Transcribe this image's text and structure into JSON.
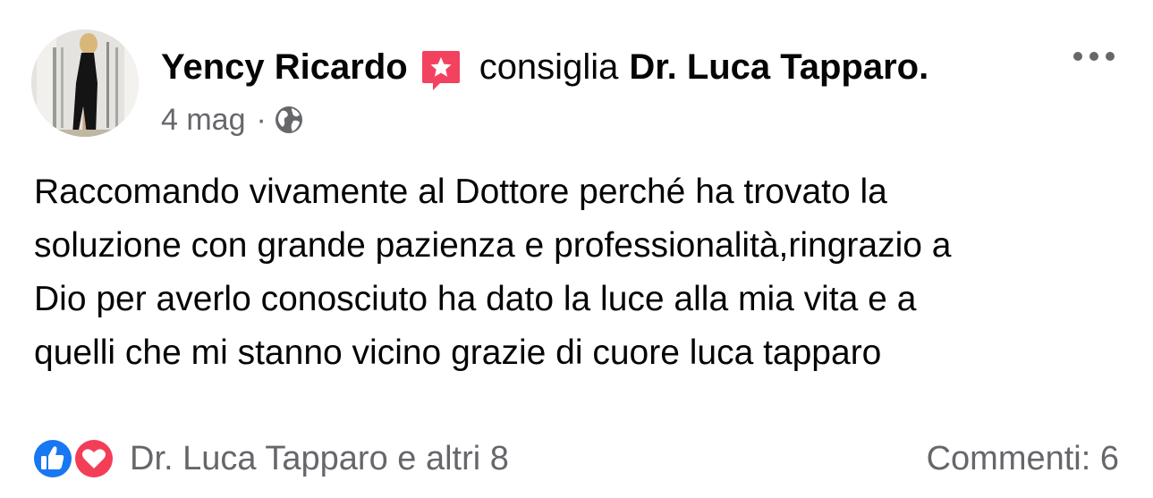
{
  "post": {
    "author": "Yency Ricardo",
    "verb": "consiglia",
    "page": "Dr. Luca Tapparo.",
    "date": "4 mag",
    "separator": "·",
    "privacy_icon": "globe-icon",
    "recommend_icon": "recommendation-flag-icon",
    "more_icon": "more-dots-icon",
    "text": "Raccomando vivamente al Dottore perché ha trovato la\nsoluzione con grande pazienza e professionalità,ringrazio a\nDio per averlo conosciuto ha dato la luce alla mia vita e a\nquelli che mi stanno vicino grazie di cuore luca tapparo"
  },
  "footer": {
    "reactions_text": "Dr. Luca Tapparo e altri 8",
    "reaction_icons": [
      "like-icon",
      "love-icon"
    ],
    "comments": "Commenti: 6"
  },
  "colors": {
    "text": "#050505",
    "secondary": "#65676b",
    "like_blue": "#1877f2",
    "love_red": "#f33e58",
    "recommend_pink": "#f3425f"
  }
}
